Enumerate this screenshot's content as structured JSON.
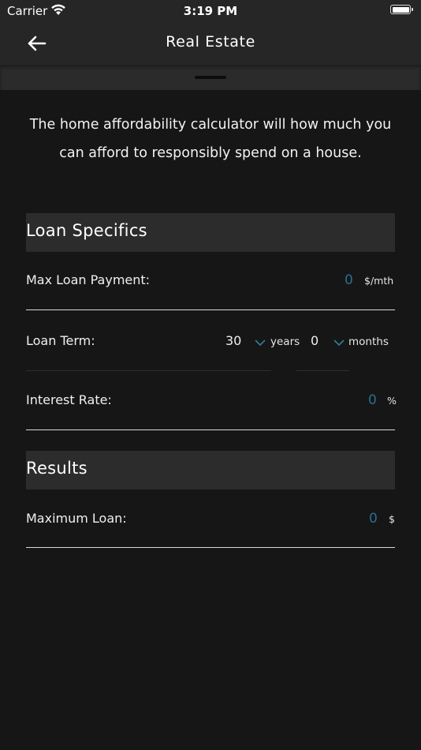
{
  "status_bar": {
    "carrier": "Carrier",
    "time": "3:19 PM",
    "icons": [
      "wifi-icon",
      "battery-icon"
    ]
  },
  "nav": {
    "back_icon": "arrow-left-icon",
    "title": "Real Estate"
  },
  "intro": {
    "text": "The home affordability calculator will how much you can afford to responsibly spend on a house."
  },
  "loan_specifics": {
    "header": "Loan Specifics",
    "max_payment": {
      "label": "Max Loan Payment:",
      "value": "0",
      "unit": "$/mth"
    },
    "loan_term": {
      "label": "Loan Term:",
      "years_value": "30",
      "years_unit": "years",
      "months_value": "0",
      "months_unit": "months"
    },
    "interest_rate": {
      "label": "Interest Rate:",
      "value": "0",
      "unit": "%"
    }
  },
  "results": {
    "header": "Results",
    "max_loan": {
      "label": "Maximum Loan:",
      "value": "0",
      "unit": "$"
    }
  },
  "colors": {
    "background": "#161616",
    "bar": "#262626",
    "section_header": "#2c2c2c",
    "value_accent": "#2b6f8f",
    "chevron": "#2d7f9e"
  }
}
